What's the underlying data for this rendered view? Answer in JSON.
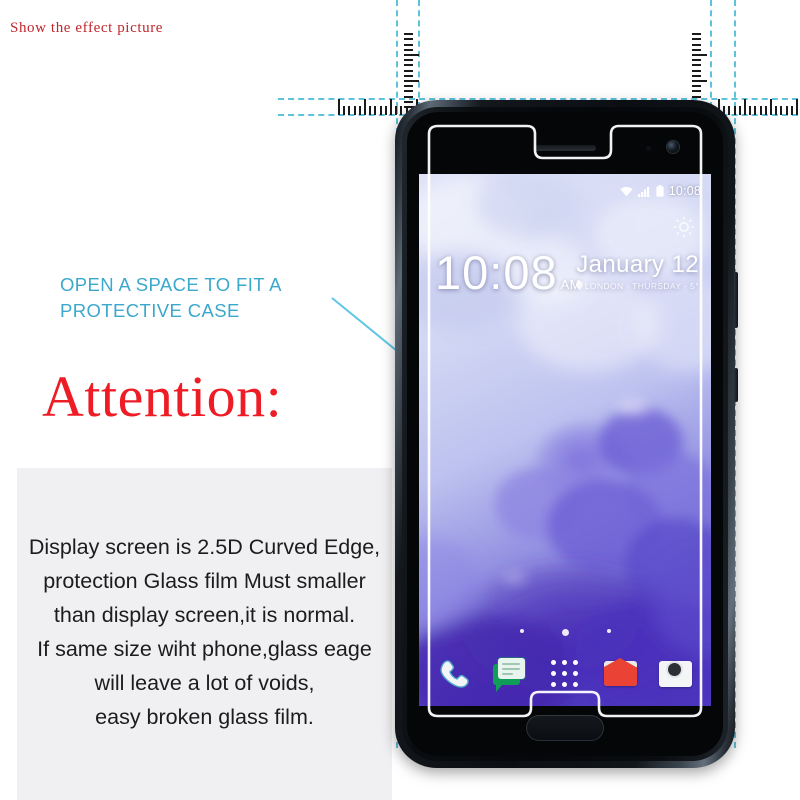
{
  "header": {
    "note": "Show the effect picture",
    "note_color": "#c0272d"
  },
  "annotation": {
    "line1": "OPEN A SPACE TO FIT A",
    "line2": "PROTECTIVE CASE",
    "color": "#3ba8cc"
  },
  "attention": {
    "label": "Attention:",
    "color": "#ee1c25"
  },
  "info": {
    "background": "#f0eff2",
    "lines": [
      "Display screen is 2.5D Curved Edge,",
      "protection Glass film Must smaller",
      "than display screen,it is normal.",
      "If same size wiht phone,glass eage",
      "will leave a lot of voids,",
      "easy broken glass film."
    ]
  },
  "guides": {
    "color": "#5fc2dd",
    "film_edge_color": "#3fb6d8"
  },
  "phone": {
    "status_bar": {
      "wifi_icon": "wifi-icon",
      "signal_icon": "signal-bars-icon",
      "battery_icon": "battery-icon",
      "time": "10:08"
    },
    "lockscreen": {
      "clock": "10:08",
      "ampm": "AM",
      "date": "January 12",
      "location_icon": "location-pin-icon",
      "weather_icon": "sun-icon",
      "details": "LONDON · THURSDAY · 5°"
    },
    "dock": [
      {
        "name": "phone-icon",
        "label": "Phone"
      },
      {
        "name": "messages-icon",
        "label": "Messages"
      },
      {
        "name": "app-drawer-icon",
        "label": "All apps"
      },
      {
        "name": "mail-icon",
        "label": "Mail"
      },
      {
        "name": "camera-icon",
        "label": "Camera"
      }
    ],
    "page_dots": 3,
    "hardware": {
      "earpiece": "earpiece-speaker",
      "front_camera": "front-camera",
      "proximity_sensor": "proximity-sensor",
      "home_button": "home-button-fingerprint"
    }
  }
}
